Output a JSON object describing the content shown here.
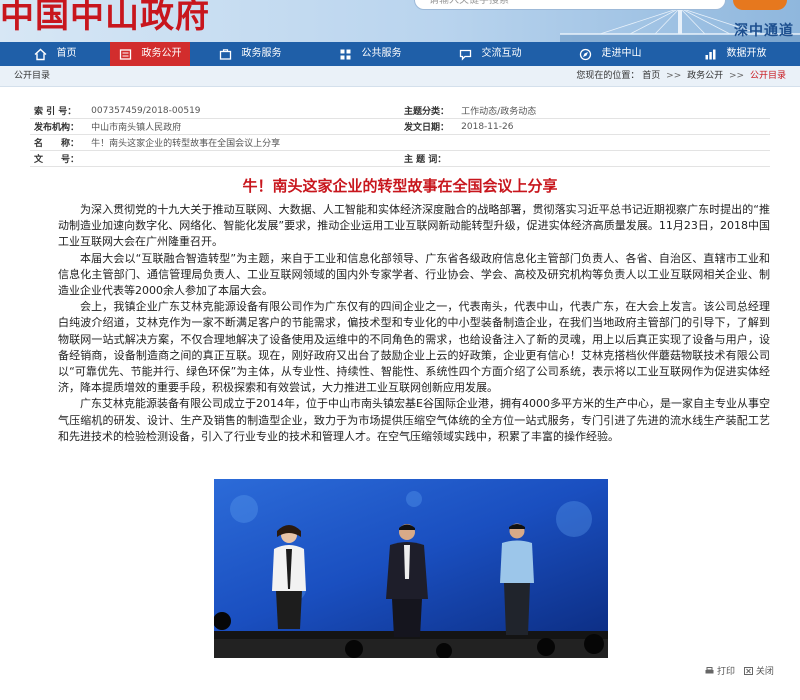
{
  "header": {
    "site_title": "中国中山政府",
    "search_placeholder": "请输入关键字搜索",
    "slogan": "深中通道"
  },
  "nav": [
    {
      "label": "首页",
      "icon": "home-icon",
      "active": false
    },
    {
      "label": "政务公开",
      "icon": "open-gov-icon",
      "active": true
    },
    {
      "label": "政务服务",
      "icon": "service-icon",
      "active": false
    },
    {
      "label": "公共服务",
      "icon": "public-service-icon",
      "active": false
    },
    {
      "label": "交流互动",
      "icon": "interaction-icon",
      "active": false
    },
    {
      "label": "走进中山",
      "icon": "explore-icon",
      "active": false
    },
    {
      "label": "数据开放",
      "icon": "data-icon",
      "active": false
    }
  ],
  "breadcrumb": {
    "title": "公开目录",
    "prefix": "您现在的位置：",
    "items": [
      "首页",
      "政务公开",
      "公开目录"
    ]
  },
  "info": {
    "index_label": "索 引 号：",
    "index_value": "007357459/2018-00519",
    "category_label": "主题分类：",
    "category_value": "工作动态/政务动态",
    "publisher_label": "发布机构：",
    "publisher_value": "中山市南头镇人民政府",
    "date_label": "发文日期：",
    "date_value": "2018-11-26",
    "name_label": "名　　称：",
    "name_value": "牛！南头这家企业的转型故事在全国会议上分享",
    "docno_label": "文　　号：",
    "docno_value": "",
    "keywords_label": "主 题 词：",
    "keywords_value": ""
  },
  "article": {
    "title": "牛！南头这家企业的转型故事在全国会议上分享",
    "paragraphs": [
      "为深入贯彻党的十九大关于推动互联网、大数据、人工智能和实体经济深度融合的战略部署，贯彻落实习近平总书记近期视察广东时提出的“推动制造业加速向数字化、网络化、智能化发展”要求，推动企业运用工业互联网新动能转型升级，促进实体经济高质量发展。11月23日，2018中国工业互联网大会在广州隆重召开。",
      "本届大会以“互联融合智造转型”为主题，来自于工业和信息化部领导、广东省各级政府信息化主管部门负责人、各省、自治区、直辖市工业和信息化主管部门、通信管理局负责人、工业互联网领域的国内外专家学者、行业协会、学会、高校及研究机构等负责人以工业互联网相关企业、制造业企业代表等2000余人参加了本届大会。",
      "会上，我镇企业广东艾林克能源设备有限公司作为广东仅有的四间企业之一，代表南头，代表中山，代表广东，在大会上发言。该公司总经理白纯波介绍道，艾林克作为一家不断满足客户的节能需求，偏技术型和专业化的中小型装备制造企业，在我们当地政府主管部门的引导下，了解到物联网一站式解决方案，不仅合理地解决了设备使用及运维中的不同角色的需求，也给设备注入了新的灵魂，用上以后真正实现了设备与用户，设备经销商，设备制造商之间的真正互联。现在，刚好政府又出台了鼓励企业上云的好政策，企业更有信心！艾林克搭档伙伴蘑菇物联技术有限公司以“可靠优先、节能并行、绿色环保”为主体，从专业性、持续性、智能性、系统性四个方面介绍了公司系统，表示将以工业互联网作为促进实体经济，降本提质增效的重要手段，积极探索和有效尝试，大力推进工业互联网创新应用发展。",
      "广东艾林克能源装备有限公司成立于2014年，位于中山市南头镇宏基E谷国际企业港，拥有4000多平方米的生产中心，是一家自主专业从事空气压缩机的研发、设计、生产及销售的制造型企业，致力于为市场提供压缩空气体统的全方位一站式服务，专门引进了先进的流水线生产装配工艺和先进技术的检验检测设备，引入了行业专业的技术和管理人才。在空气压缩领域实践中，积累了丰富的操作经验。"
    ]
  },
  "footer": {
    "print_label": "打印",
    "close_label": "关闭"
  },
  "colors": {
    "nav_bg": "#1f5fa8",
    "nav_active": "#d22d2d",
    "title_red": "#c8161d"
  }
}
